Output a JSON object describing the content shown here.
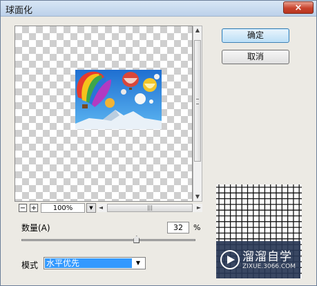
{
  "dialog": {
    "title": "球面化",
    "close_glyph": "×"
  },
  "preview": {
    "image_desc_icon": "hot-air-balloons-image"
  },
  "zoom": {
    "minus_glyph": "−",
    "plus_glyph": "+",
    "value": "100%",
    "dropdown_glyph": "▼",
    "left_arrow": "◄",
    "right_arrow": "►",
    "thumb_grip": "|||"
  },
  "vscroll": {
    "up_arrow": "▲",
    "down_arrow": "▼"
  },
  "buttons": {
    "ok_label": "确定",
    "cancel_label": "取消"
  },
  "amount": {
    "label": "数量(A)",
    "value": "32",
    "unit": "%",
    "slider_fraction": 0.66
  },
  "mode": {
    "label": "模式",
    "value": "水平优先",
    "dropdown_glyph": "▼"
  },
  "watermark": {
    "name": "溜溜自学",
    "url": "ZIXUE.3066.COM"
  }
}
